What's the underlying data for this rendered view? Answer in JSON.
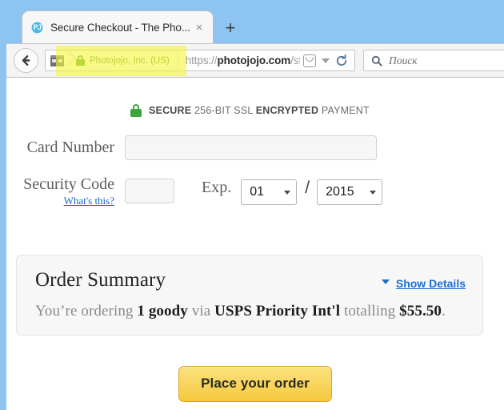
{
  "browser": {
    "tab": {
      "title": "Secure Checkout - The Pho...",
      "favicon_text": "PJ",
      "favicon_name": "photojojo-favicon",
      "close_glyph": "×"
    },
    "new_tab_glyph": "+",
    "back_button_name": "back-button",
    "url_bar": {
      "identity_icon": "page-info-icon",
      "ev_certificate": "Photojojo, Inc. (US)",
      "url_prefix": "https://",
      "url_domain": "photojojo.com",
      "url_path": "/store/newchec",
      "pocket_icon": "pocket-icon",
      "dropdown_icon": "history-dropdown-icon",
      "reload_icon": "reload-icon"
    },
    "search": {
      "placeholder": "Поиск",
      "icon": "search-icon"
    },
    "highlight_color": "#f6f63e"
  },
  "page": {
    "secure_banner": {
      "lock_icon": "green-padlock-icon",
      "part1": "SECURE",
      "part2": "256-BIT SSL",
      "part3": "ENCRYPTED",
      "part4": "PAYMENT"
    },
    "form": {
      "card_number_label": "Card Number",
      "card_number_value": "",
      "security_code_label": "Security Code",
      "security_code_value": "",
      "whats_this_link": "What's this?",
      "exp_label": "Exp.",
      "exp_month": "01",
      "exp_separator": "/",
      "exp_year": "2015"
    },
    "order_summary": {
      "title": "Order Summary",
      "show_details_label": "Show Details",
      "line_prefix": "You’re ordering ",
      "quantity": "1 goody",
      "line_via": " via ",
      "shipping": "USPS Priority Int'l",
      "line_totalling": " totalling ",
      "total": "$55.50",
      "line_period": "."
    },
    "cta": {
      "label": "Place your order"
    },
    "colors": {
      "link_blue": "#1a6fd4",
      "secure_green": "#39a53c",
      "ev_green": "#5d9b3d",
      "cta_yellow": "#f8d661"
    }
  }
}
